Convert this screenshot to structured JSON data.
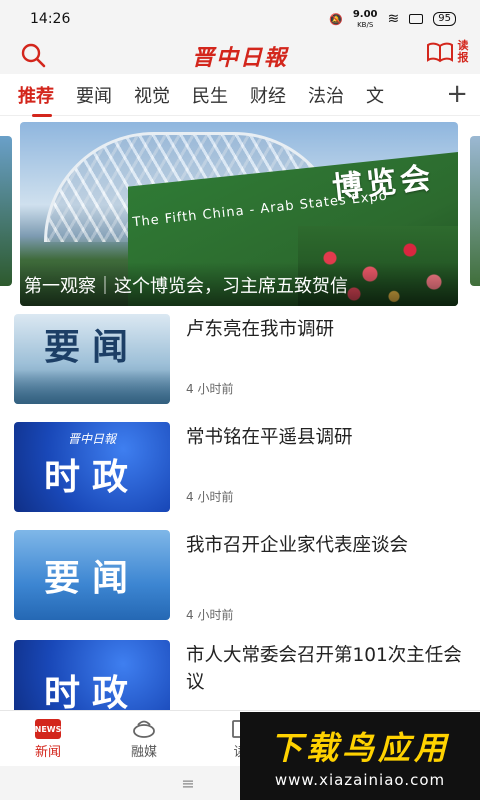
{
  "status": {
    "time": "14:26",
    "speed": "9.00",
    "speed_unit": "KB/S",
    "battery": "95"
  },
  "header": {
    "logo": "晋中日報",
    "read_paper": "读报"
  },
  "tabs": [
    "推荐",
    "要闻",
    "视觉",
    "民生",
    "财经",
    "法治",
    "文"
  ],
  "tabs_more": "+",
  "banner": {
    "caption": "第一观察｜这个博览会，习主席五致贺信",
    "hedge_text": "博览会",
    "hedge_sub": "The Fifth China - Arab States Expo"
  },
  "news": [
    {
      "thumb_text": "要闻",
      "title": "卢东亮在我市调研",
      "time": "4 小时前"
    },
    {
      "thumb_text": "时政",
      "thumb_logo": "晋中日報",
      "title": "常书铭在平遥县调研",
      "time": "4 小时前"
    },
    {
      "thumb_text": "要闻",
      "title": "我市召开企业家代表座谈会",
      "time": "4 小时前"
    },
    {
      "thumb_text": "时政",
      "title": "市人大常委会召开第101次主任会议",
      "time": ""
    }
  ],
  "bottom_nav": [
    {
      "label": "新闻",
      "icon": "news-icon",
      "active": true
    },
    {
      "label": "融媒",
      "icon": "media-icon",
      "active": false
    },
    {
      "label": "读",
      "icon": "read-icon",
      "active": false
    }
  ],
  "system_nav": {
    "menu": "≡",
    "home": "○"
  },
  "watermark": {
    "line1": "下载鸟应用",
    "line2": "www.xiazainiao.com"
  },
  "colors": {
    "accent": "#d3261c"
  }
}
